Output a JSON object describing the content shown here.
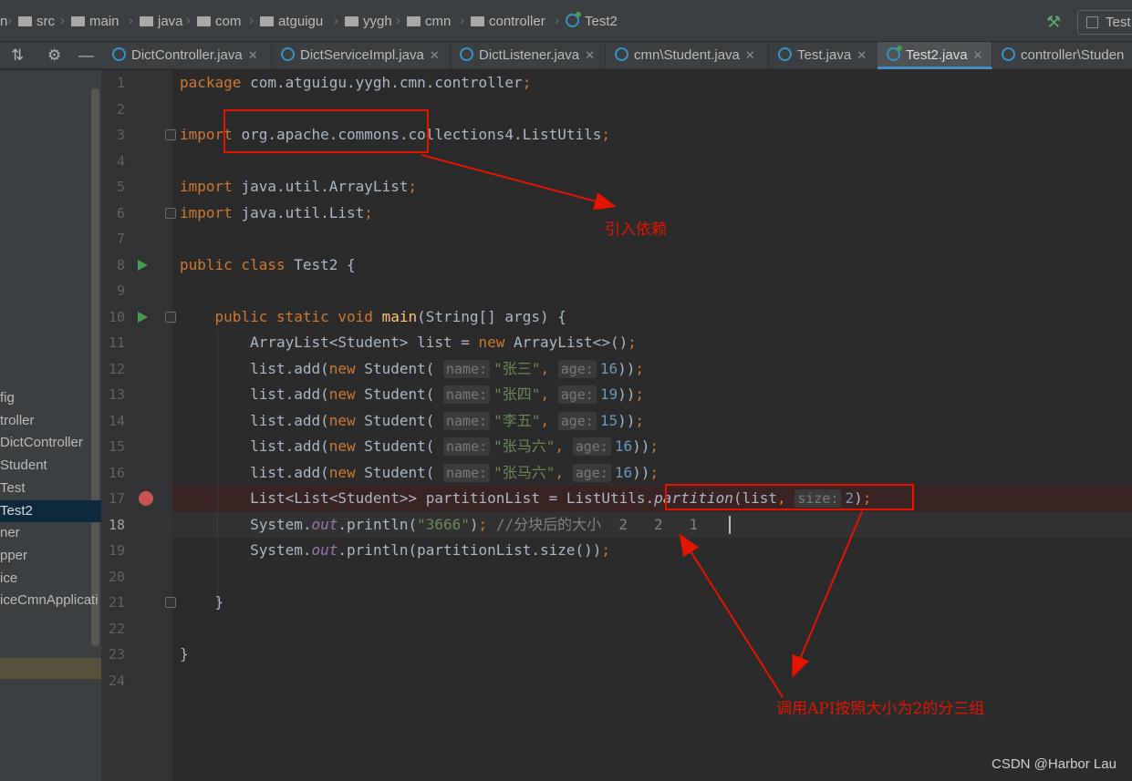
{
  "breadcrumb": {
    "items": [
      {
        "label": "n",
        "folder": false
      },
      {
        "label": "src",
        "folder": true
      },
      {
        "label": "main",
        "folder": true
      },
      {
        "label": "java",
        "folder": true
      },
      {
        "label": "com",
        "folder": true
      },
      {
        "label": "atguigu",
        "folder": true
      },
      {
        "label": "yygh",
        "folder": true
      },
      {
        "label": "cmn",
        "folder": true
      },
      {
        "label": "controller",
        "folder": true
      },
      {
        "label": "Test2",
        "folder": false
      }
    ]
  },
  "run_config": {
    "label": "Test"
  },
  "tabs": [
    {
      "label": "DictController.java",
      "active": false
    },
    {
      "label": "DictServiceImpl.java",
      "active": false
    },
    {
      "label": "DictListener.java",
      "active": false
    },
    {
      "label": "cmn\\Student.java",
      "active": false
    },
    {
      "label": "Test.java",
      "active": false
    },
    {
      "label": "Test2.java",
      "active": true
    },
    {
      "label": "controller\\Studen",
      "active": false
    }
  ],
  "project_tree": [
    "fig",
    "troller",
    "DictController",
    "Student",
    "Test",
    "Test2",
    "ner",
    "pper",
    "ice",
    "iceCmnApplicati"
  ],
  "editor": {
    "current_line": 18,
    "breakpoint_line": 17,
    "lines": [
      [
        [
          "kw",
          "package "
        ],
        [
          "",
          "com.atguigu.yygh.cmn.controller"
        ],
        [
          "kw",
          ";"
        ]
      ],
      [],
      [
        [
          "kw",
          "import "
        ],
        [
          "",
          "org.apache.commons.collections4.ListUtils"
        ],
        [
          "kw",
          ";"
        ]
      ],
      [],
      [
        [
          "kw",
          "import "
        ],
        [
          "",
          "java.util.ArrayList"
        ],
        [
          "kw",
          ";"
        ]
      ],
      [
        [
          "kw",
          "import "
        ],
        [
          "",
          "java.util.List"
        ],
        [
          "kw",
          ";"
        ]
      ],
      [],
      [
        [
          "kw",
          "public class "
        ],
        [
          "",
          "Test2 {"
        ]
      ],
      [],
      [
        [
          "",
          "    "
        ],
        [
          "kw",
          "public static void "
        ],
        [
          "mth",
          "main"
        ],
        [
          "",
          "(String[] args) {"
        ]
      ],
      [
        [
          "",
          "        ArrayList<Student> list = "
        ],
        [
          "kw",
          "new "
        ],
        [
          "",
          "ArrayList<>()"
        ],
        [
          "kw",
          ";"
        ]
      ],
      [
        [
          "",
          "        list.add("
        ],
        [
          "kw",
          "new "
        ],
        [
          "",
          "Student( "
        ],
        [
          "hint",
          "name:"
        ],
        [
          "str",
          "\"张三\""
        ],
        [
          "kw",
          ", "
        ],
        [
          "hint",
          "age:"
        ],
        [
          "num",
          "16"
        ],
        [
          "",
          "))"
        ],
        [
          "kw",
          ";"
        ]
      ],
      [
        [
          "",
          "        list.add("
        ],
        [
          "kw",
          "new "
        ],
        [
          "",
          "Student( "
        ],
        [
          "hint",
          "name:"
        ],
        [
          "str",
          "\"张四\""
        ],
        [
          "kw",
          ", "
        ],
        [
          "hint",
          "age:"
        ],
        [
          "num",
          "19"
        ],
        [
          "",
          "))"
        ],
        [
          "kw",
          ";"
        ]
      ],
      [
        [
          "",
          "        list.add("
        ],
        [
          "kw",
          "new "
        ],
        [
          "",
          "Student( "
        ],
        [
          "hint",
          "name:"
        ],
        [
          "str",
          "\"李五\""
        ],
        [
          "kw",
          ", "
        ],
        [
          "hint",
          "age:"
        ],
        [
          "num",
          "15"
        ],
        [
          "",
          "))"
        ],
        [
          "kw",
          ";"
        ]
      ],
      [
        [
          "",
          "        list.add("
        ],
        [
          "kw",
          "new "
        ],
        [
          "",
          "Student( "
        ],
        [
          "hint",
          "name:"
        ],
        [
          "str",
          "\"张马六\""
        ],
        [
          "kw",
          ", "
        ],
        [
          "hint",
          "age:"
        ],
        [
          "num",
          "16"
        ],
        [
          "",
          "))"
        ],
        [
          "kw",
          ";"
        ]
      ],
      [
        [
          "",
          "        list.add("
        ],
        [
          "kw",
          "new "
        ],
        [
          "",
          "Student( "
        ],
        [
          "hint",
          "name:"
        ],
        [
          "str",
          "\"张马六\""
        ],
        [
          "kw",
          ", "
        ],
        [
          "hint",
          "age:"
        ],
        [
          "num",
          "16"
        ],
        [
          "",
          "))"
        ],
        [
          "kw",
          ";"
        ]
      ],
      [
        [
          "",
          "        List<List<Student>> partitionList = ListUtils."
        ],
        [
          "it",
          "partition"
        ],
        [
          "",
          "(list"
        ],
        [
          "kw",
          ", "
        ],
        [
          "hint",
          "size:"
        ],
        [
          "num",
          "2"
        ],
        [
          "",
          ")"
        ],
        [
          "kw",
          ";"
        ]
      ],
      [
        [
          "",
          "        System."
        ],
        [
          "fld",
          "out"
        ],
        [
          "",
          ".println("
        ],
        [
          "str",
          "\"3666\""
        ],
        [
          "",
          ")"
        ],
        [
          "kw",
          "; "
        ],
        [
          "cmt",
          "//分块后的大小  2   2   1"
        ]
      ],
      [
        [
          "",
          "        System."
        ],
        [
          "fld",
          "out"
        ],
        [
          "",
          ".println(partitionList.size())"
        ],
        [
          "kw",
          ";"
        ]
      ],
      [],
      [
        [
          "",
          "    }"
        ]
      ],
      [],
      [
        [
          "",
          "}"
        ]
      ],
      []
    ]
  },
  "annotations": {
    "import_note": "引入依赖",
    "partition_note": "调用API按照大小为2的分三组"
  },
  "watermark": "CSDN @Harbor Lau"
}
